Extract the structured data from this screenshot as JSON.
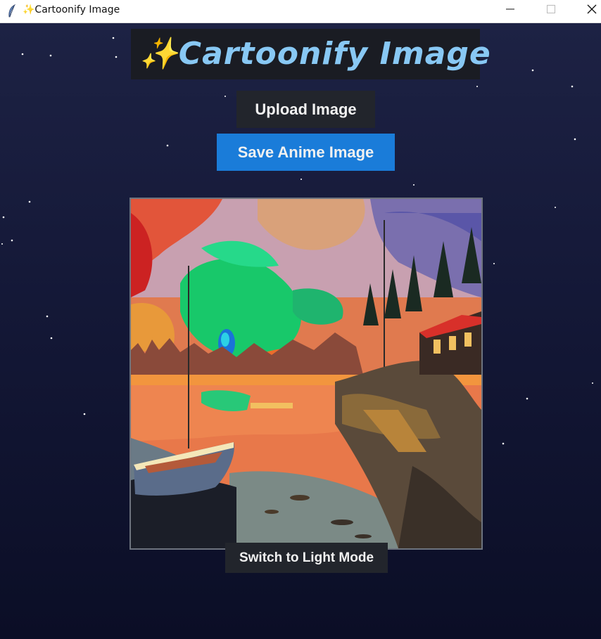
{
  "window": {
    "title": "✨Cartoonify Image",
    "app_icon": "feather-icon",
    "controls": {
      "minimize_icon": "minimize-icon",
      "maximize_icon": "maximize-icon",
      "close_icon": "close-icon"
    }
  },
  "app": {
    "heading": "✨Cartoonify Image",
    "upload_label": "Upload Image",
    "save_label": "Save Anime Image",
    "theme_toggle_label": "Switch to Light Mode",
    "image": {
      "description_visible": false
    }
  },
  "colors": {
    "background_top": "#1d2244",
    "background_bottom": "#0b0e26",
    "heading_text": "#88c8f4",
    "heading_bg": "#1a1c23",
    "dark_button": "#22252c",
    "accent_button": "#1a7cd9"
  }
}
